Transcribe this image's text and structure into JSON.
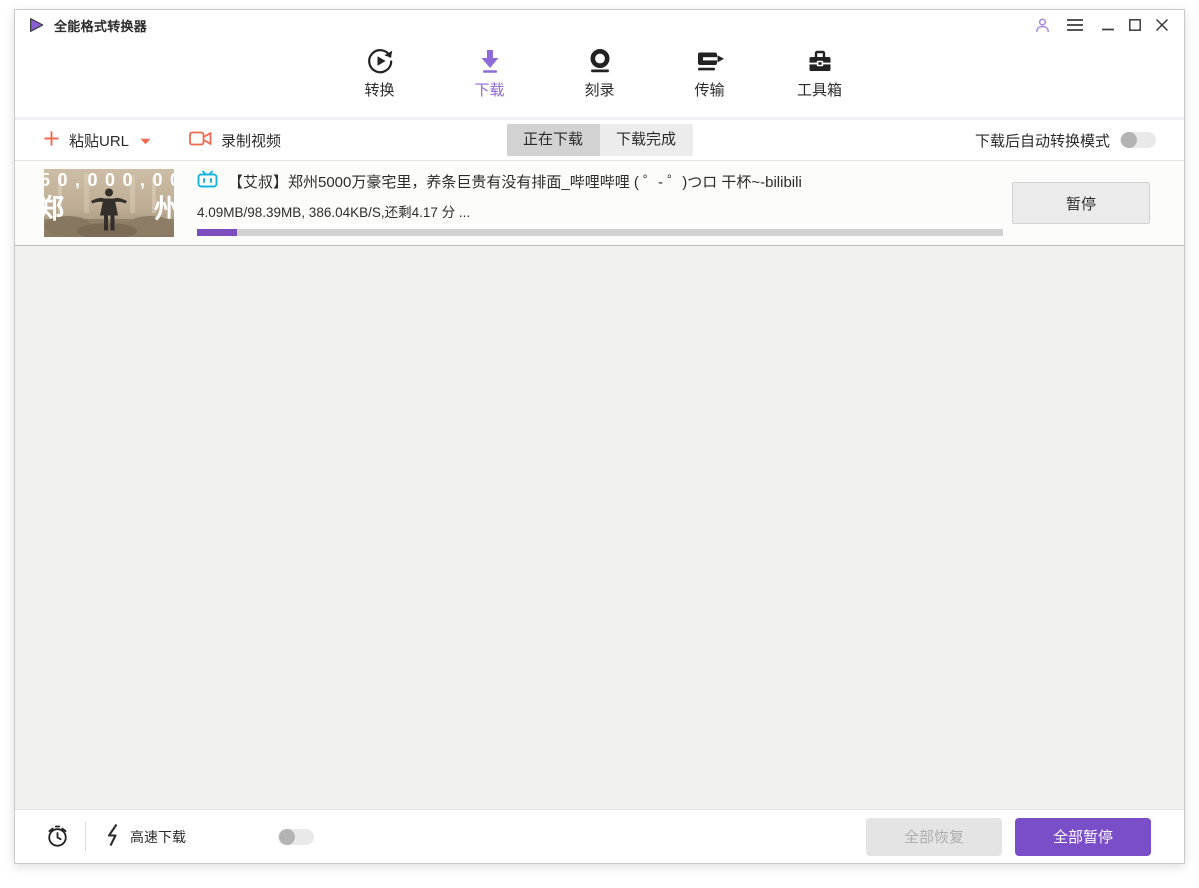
{
  "titlebar": {
    "title": "全能格式转换器"
  },
  "nav": {
    "tabs": [
      {
        "label": "转换",
        "icon": "convert-icon",
        "active": false
      },
      {
        "label": "下载",
        "icon": "download-icon",
        "active": true
      },
      {
        "label": "刻录",
        "icon": "burn-icon",
        "active": false
      },
      {
        "label": "传输",
        "icon": "transfer-icon",
        "active": false
      },
      {
        "label": "工具箱",
        "icon": "toolbox-icon",
        "active": false
      }
    ]
  },
  "toolbar": {
    "paste_url_label": "粘贴URL",
    "record_video_label": "录制视频",
    "downloading_tab": "正在下载",
    "completed_tab": "下载完成",
    "auto_convert_label": "下载后自动转换模式",
    "auto_convert_enabled": false
  },
  "download_item": {
    "source": "bilibili",
    "title": "【艾叔】郑州5000万豪宅里，养条巨贵有没有排面_哔哩哔哩 ( ゜- ゜)つロ 干杯~-bilibili",
    "progress_text": "4.09MB/98.39MB, 386.04KB/S,还剩4.17 分 ...",
    "progress_percent": 5,
    "pause_label": "暂停",
    "thumbnail": {
      "price_text": "50,000,00",
      "left_char": "郑",
      "right_char": "州"
    }
  },
  "footer": {
    "speed_label": "高速下载",
    "speed_enabled": false,
    "resume_all_label": "全部恢复",
    "pause_all_label": "全部暂停"
  },
  "colors": {
    "accent_purple": "#7b4ec9",
    "nav_active_purple": "#8f6ad8",
    "progress_fill": "#7b4dbe",
    "action_red": "#ed6a4e",
    "bilibili_blue": "#18b3dd"
  }
}
